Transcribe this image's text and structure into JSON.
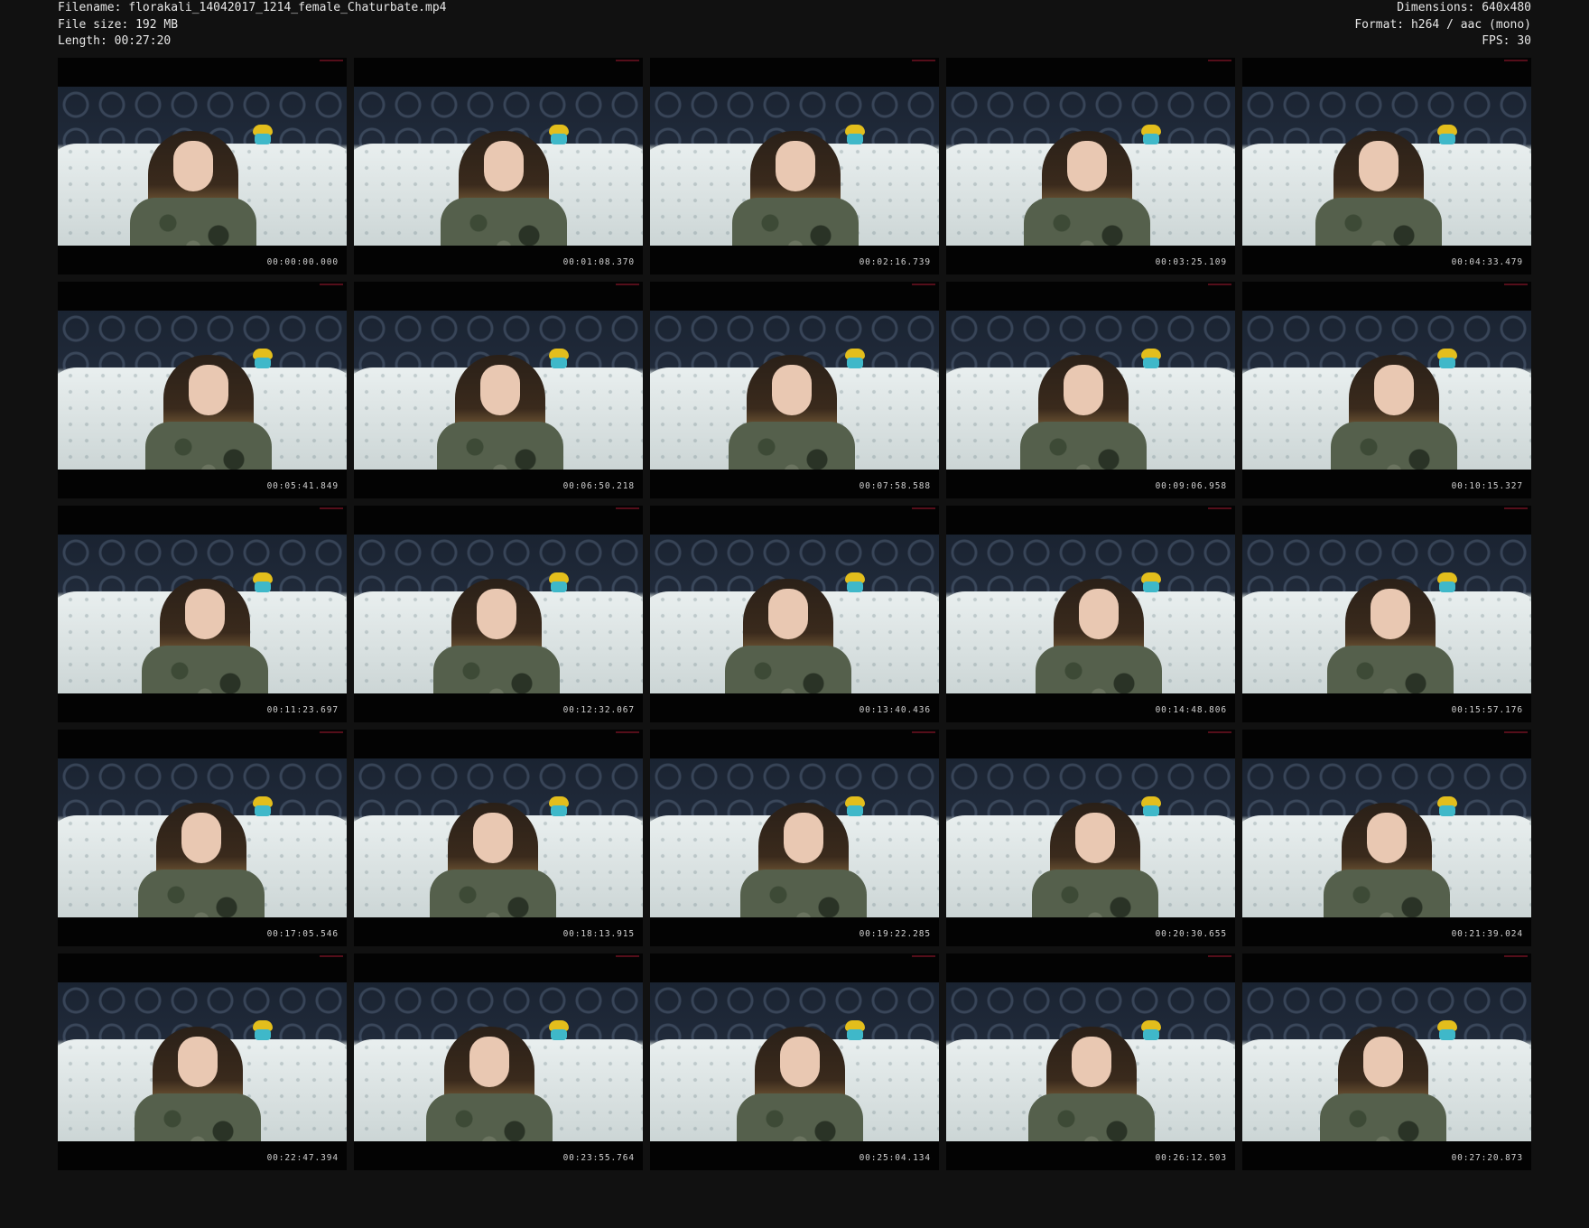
{
  "header": {
    "filename": "Filename: florakali_14042017_1214_female_Chaturbate.mp4",
    "filesize": "File size: 192 MB",
    "length": "Length: 00:27:20",
    "dimensions": "Dimensions: 640x480",
    "format": "Format: h264 / aac (mono)",
    "fps": "FPS: 30"
  },
  "thumbnails": [
    "00:00:00.000",
    "00:01:08.370",
    "00:02:16.739",
    "00:03:25.109",
    "00:04:33.479",
    "00:05:41.849",
    "00:06:50.218",
    "00:07:58.588",
    "00:09:06.958",
    "00:10:15.327",
    "00:11:23.697",
    "00:12:32.067",
    "00:13:40.436",
    "00:14:48.806",
    "00:15:57.176",
    "00:17:05.546",
    "00:18:13.915",
    "00:19:22.285",
    "00:20:30.655",
    "00:21:39.024",
    "00:22:47.394",
    "00:23:55.764",
    "00:25:04.134",
    "00:26:12.503",
    "00:27:20.873"
  ]
}
